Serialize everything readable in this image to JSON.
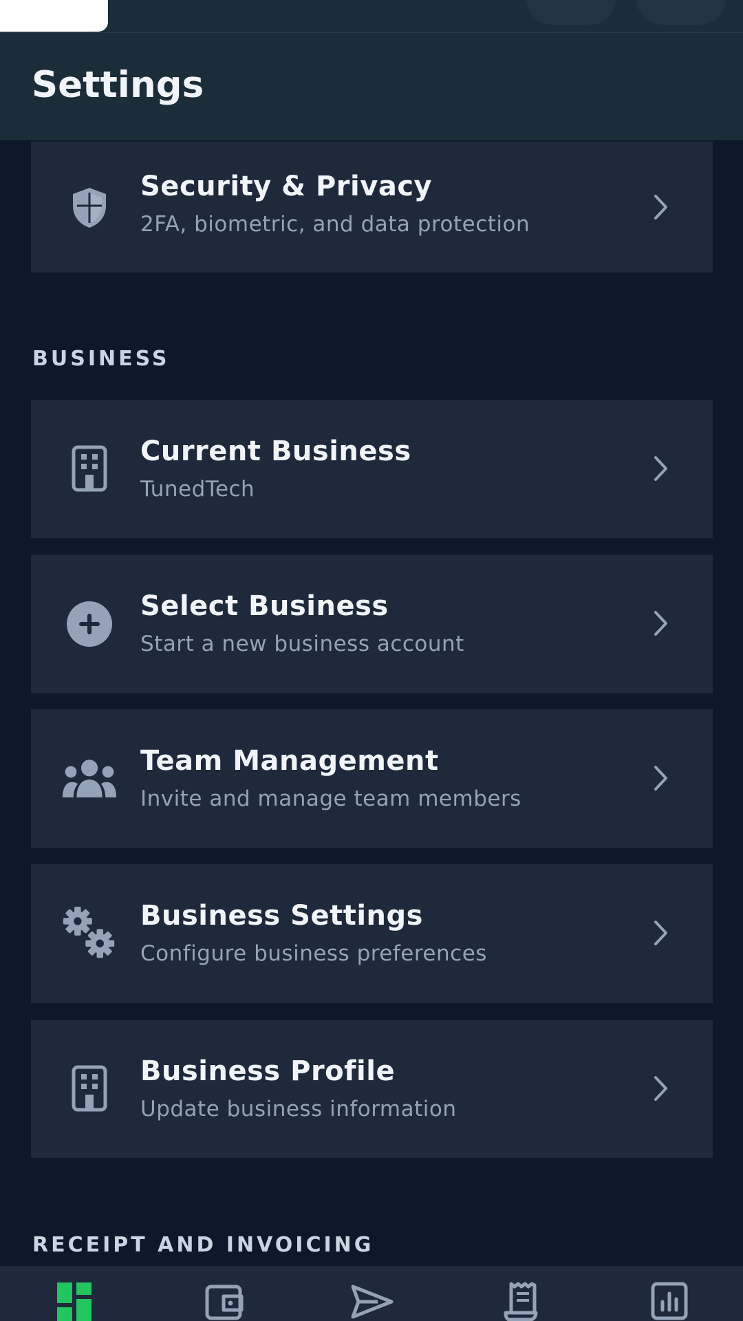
{
  "header": {
    "title": "Settings"
  },
  "security_card": {
    "title": "Security & Privacy",
    "subtitle": "2FA, biometric, and data protection",
    "icon": "shield-icon"
  },
  "business_section": {
    "label": "BUSINESS",
    "items": [
      {
        "title": "Current Business",
        "subtitle": "TunedTech",
        "icon": "building-icon"
      },
      {
        "title": "Select Business",
        "subtitle": "Start a new business account",
        "icon": "plus-circle-icon"
      },
      {
        "title": "Team Management",
        "subtitle": "Invite and manage team members",
        "icon": "users-icon"
      },
      {
        "title": "Business Settings",
        "subtitle": "Configure business preferences",
        "icon": "gears-icon"
      },
      {
        "title": "Business Profile",
        "subtitle": "Update business information",
        "icon": "building-icon"
      }
    ]
  },
  "receipt_section": {
    "label": "RECEIPT AND INVOICING"
  },
  "bottom_nav": {
    "items": [
      {
        "icon": "dashboard-icon",
        "active": true
      },
      {
        "icon": "wallet-icon",
        "active": false
      },
      {
        "icon": "send-icon",
        "active": false
      },
      {
        "icon": "receipt-icon",
        "active": false
      },
      {
        "icon": "chart-icon",
        "active": false
      }
    ]
  },
  "colors": {
    "background": "#0f172a",
    "card": "#1e293b",
    "header": "#1c2d3a",
    "text_primary": "#f1f5f9",
    "text_secondary": "#94a3b8",
    "accent": "#22c55e"
  }
}
